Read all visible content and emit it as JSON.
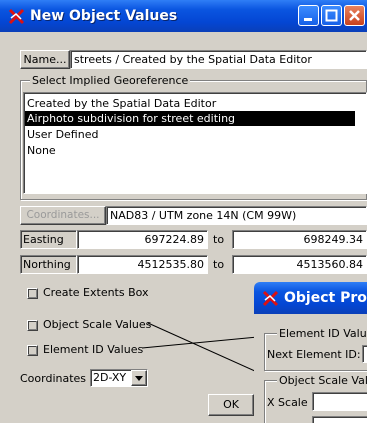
{
  "window": {
    "title": "New Object Values",
    "controls": [
      "minimize",
      "maximize",
      "close"
    ]
  },
  "name_row": {
    "button_label": "Name...",
    "value": "streets / Created by the Spatial Data Editor"
  },
  "georeference": {
    "group_label": "Select Implied Georeference",
    "items": [
      {
        "label": "Created by the Spatial Data Editor",
        "selected": false
      },
      {
        "label": "Airphoto subdivision for street editing",
        "selected": true
      },
      {
        "label": "User Defined",
        "selected": false
      },
      {
        "label": "None",
        "selected": false
      }
    ]
  },
  "coordinates_row": {
    "button_label": "Coordinates...",
    "value": "NAD83 / UTM zone 14N (CM 99W)"
  },
  "extents": {
    "easting_label": "Easting",
    "easting_from": "697224.89",
    "easting_to_label": "to",
    "easting_to": "698249.34",
    "northing_label": "Northing",
    "northing_from": "4512535.80",
    "northing_to_label": "to",
    "northing_to": "4513560.84"
  },
  "options": {
    "create_extents": "Create Extents Box",
    "object_scale": "Object Scale Values",
    "element_id": "Element ID Values",
    "coordinates_label": "Coordinates",
    "coordinates_value": "2D-XY"
  },
  "ok_button": "OK",
  "object_properties_window": {
    "title": "Object Prope",
    "element_id_group": "Element ID Value",
    "next_element_label": "Next Element ID:",
    "scale_group": "Object Scale Val",
    "x_scale_label": "X Scale"
  },
  "colors": {
    "titlebar": "#0a55e0",
    "face": "#d4d0c8",
    "selection": "#000000"
  },
  "icons": [
    "spatial-editor-app-icon",
    "minimize-icon",
    "maximize-icon",
    "close-icon",
    "dropdown-arrow-icon"
  ]
}
